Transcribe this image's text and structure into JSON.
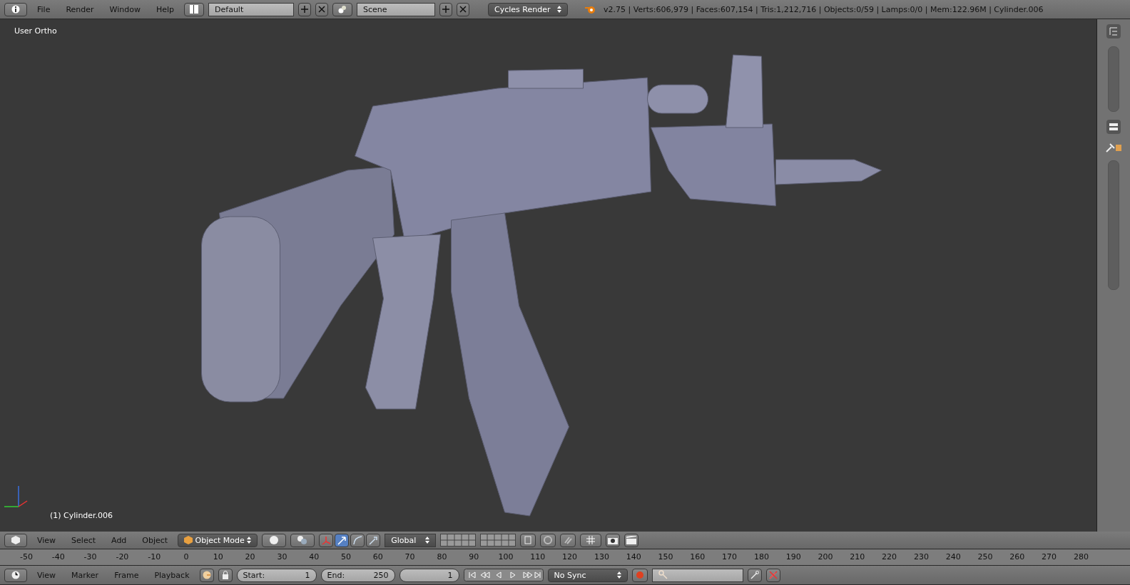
{
  "topbar": {
    "menus": [
      "File",
      "Render",
      "Window",
      "Help"
    ],
    "screen_layout": "Default",
    "scene": "Scene",
    "render_engine": "Cycles Render",
    "stats": "v2.75 | Verts:606,979 | Faces:607,154 | Tris:1,212,716 | Objects:0/59 | Lamps:0/0 | Mem:122.96M | Cylinder.006"
  },
  "viewport": {
    "view_label": "User Ortho",
    "object_label": "(1) Cylinder.006"
  },
  "view3d_header": {
    "menus": [
      "View",
      "Select",
      "Add",
      "Object"
    ],
    "mode": "Object Mode",
    "orientation": "Global",
    "manipulators": [
      {
        "kind": "axes",
        "selected": false
      },
      {
        "kind": "translate",
        "selected": true
      },
      {
        "kind": "rotate",
        "selected": false
      },
      {
        "kind": "scale",
        "selected": false
      }
    ]
  },
  "timeline": {
    "ruler": [
      "-50",
      "-40",
      "-30",
      "-20",
      "-10",
      "0",
      "10",
      "20",
      "30",
      "40",
      "50",
      "60",
      "70",
      "80",
      "90",
      "100",
      "110",
      "120",
      "130",
      "140",
      "150",
      "160",
      "170",
      "180",
      "190",
      "200",
      "210",
      "220",
      "230",
      "240",
      "250",
      "260",
      "270",
      "280"
    ],
    "menus": [
      "View",
      "Marker",
      "Frame",
      "Playback"
    ],
    "start_label": "Start:",
    "start": "1",
    "end_label": "End:",
    "end": "250",
    "current_frame": "1",
    "sync": "No Sync"
  }
}
